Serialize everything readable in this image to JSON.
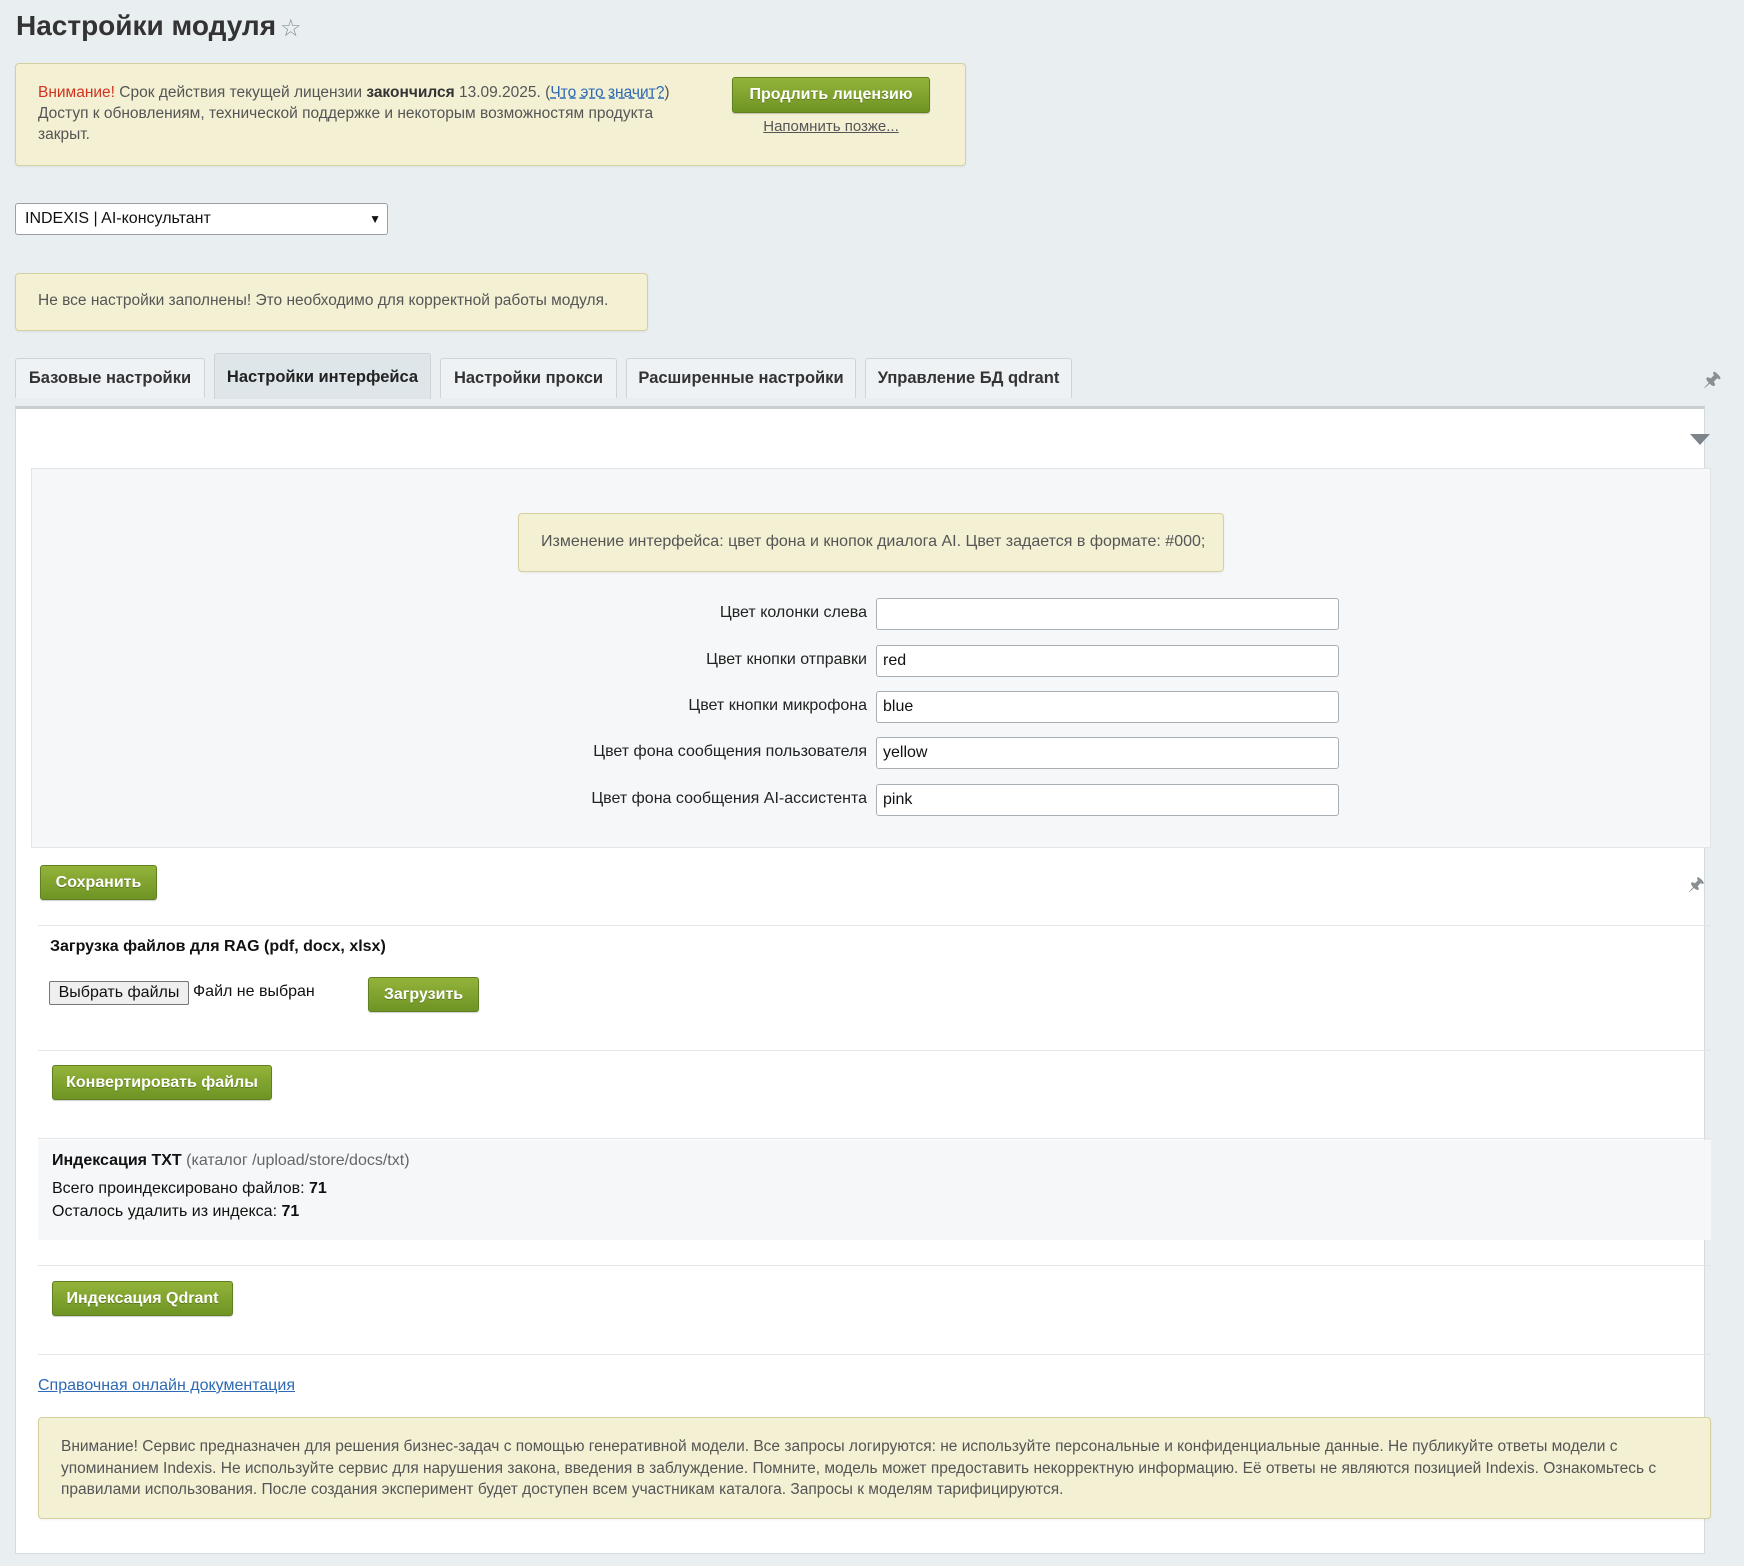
{
  "page": {
    "title": "Настройки модуля"
  },
  "license": {
    "warning_word": "Внимание!",
    "text_before": " Срок действия текущей лицензии ",
    "bold_word": "закончился",
    "date_text": " 13.09.2025. (",
    "help_link": "Что это значит?",
    "close_paren": ")",
    "line2": "Доступ к обновлениям, технической поддержке и некоторым возможностям продукта закрыт.",
    "extend_button": "Продлить лицензию",
    "remind_link": "Напомнить позже..."
  },
  "module_select": {
    "value": "INDEXIS | AI-консультант"
  },
  "settings_warning": "Не все настройки заполнены! Это необходимо для корректной работы модуля.",
  "tabs": [
    {
      "label": "Базовые настройки"
    },
    {
      "label": "Настройки интерфейса",
      "active": true
    },
    {
      "label": "Настройки прокси"
    },
    {
      "label": "Расширенные настройки"
    },
    {
      "label": "Управление БД qdrant"
    }
  ],
  "interface": {
    "info": "Изменение интерфейса: цвет фона и кнопок диалога AI. Цвет задается в формате: #000;",
    "fields": [
      {
        "label": "Цвет колонки слева",
        "value": ""
      },
      {
        "label": "Цвет кнопки отправки",
        "value": "red"
      },
      {
        "label": "Цвет кнопки микрофона",
        "value": "blue"
      },
      {
        "label": "Цвет фона сообщения пользователя",
        "value": "yellow"
      },
      {
        "label": "Цвет фона сообщения AI-ассистента",
        "value": "pink"
      }
    ],
    "save_button": "Сохранить"
  },
  "rag": {
    "title": "Загрузка файлов для RAG (pdf, docx, xlsx)",
    "choose_button": "Выбрать файлы",
    "file_status": "Файл не выбран",
    "upload_button": "Загрузить",
    "convert_button": "Конвертировать файлы"
  },
  "indexing": {
    "title": "Индексация TXT",
    "path": " (каталог /upload/store/docs/txt)",
    "total_label": "Всего проиндексировано файлов: ",
    "total_value": "71",
    "remaining_label": "Осталось удалить из индекса: ",
    "remaining_value": "71",
    "qdrant_button": "Индексация Qdrant"
  },
  "doc_link": "Справочная онлайн документация",
  "disclaimer": "Внимание! Сервис предназначен для решения бизнес-задач с помощью генеративной модели. Все запросы логируются: не используйте персональные и конфиденциальные данные. Не публикуйте ответы модели с упоминанием Indexis. Не используйте сервис для нарушения закона, введения в заблуждение. Помните, модель может предоставить некорректную информацию. Её ответы не являются позицией Indexis. Ознакомьтесь с правилами использования. После создания эксперимент будет доступен всем участникам каталога. Запросы к моделям тарифицируются.",
  "colors": {
    "accent_green": "#7ea22f",
    "note_bg": "#f3f0d4",
    "warning_red": "#d3331d",
    "link_blue": "#2d6ab3"
  },
  "icons": {
    "favorite": "star-icon",
    "pin": "pin-icon",
    "collapse": "triangle-down-icon",
    "select_chevron": "chevron-down-icon"
  }
}
